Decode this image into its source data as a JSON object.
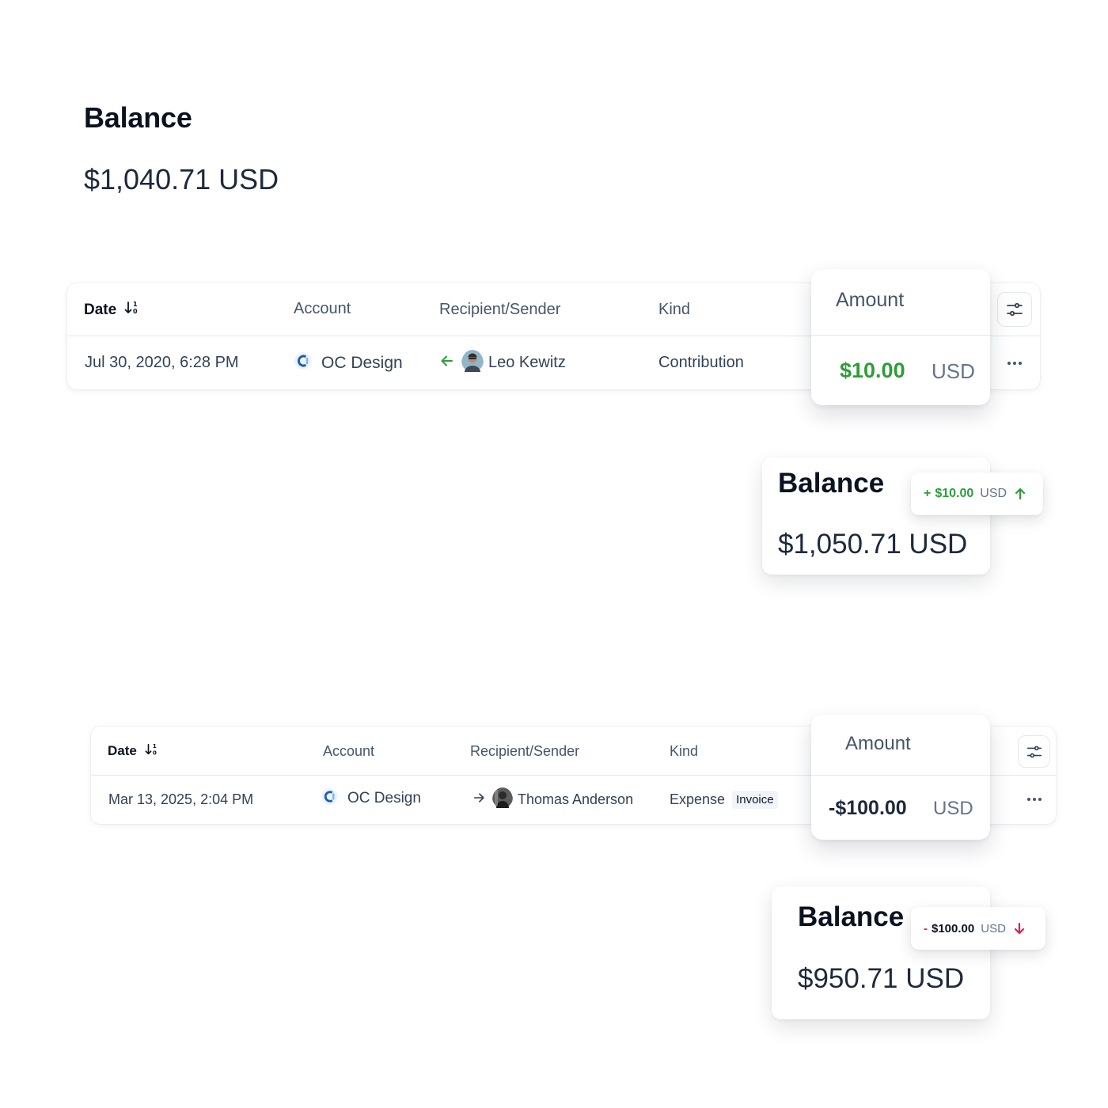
{
  "balance": {
    "title": "Balance",
    "amount": "$1,040.71 USD"
  },
  "columns": {
    "date": "Date",
    "account": "Account",
    "recipient": "Recipient/Sender",
    "kind": "Kind",
    "amount": "Amount"
  },
  "transactions": [
    {
      "date": "Jul 30, 2020, 6:28 PM",
      "account": "OC Design",
      "direction": "incoming",
      "counterparty": "Leo Kewitz",
      "kind": "Contribution",
      "badge": "",
      "amount": "$10.00",
      "currency": "USD",
      "amount_color": "#2e9d3a"
    },
    {
      "date": "Mar 13, 2025, 2:04 PM",
      "account": "OC Design",
      "direction": "outgoing",
      "counterparty": "Thomas Anderson",
      "kind": "Expense",
      "badge": "Invoice",
      "amount": "-$100.00",
      "currency": "USD",
      "amount_color": "#1e293b"
    }
  ],
  "balance_after": [
    {
      "title": "Balance",
      "amount": "$1,050.71 USD",
      "delta": {
        "sign": "+",
        "amount": "$10.00",
        "currency": "USD",
        "color": "#2e9d3a",
        "icon": "arrow-up-icon"
      }
    },
    {
      "title": "Balance",
      "amount": "$950.71 USD",
      "delta": {
        "sign": "-",
        "amount": "$100.00",
        "currency": "USD",
        "color": "#e11d48",
        "icon": "arrow-down-icon"
      }
    }
  ],
  "icons": {
    "sort": "sort-descending-icon",
    "filter": "sliders-icon",
    "more": "more-horizontal-icon",
    "account_logo": "oc-design-logo-icon"
  }
}
